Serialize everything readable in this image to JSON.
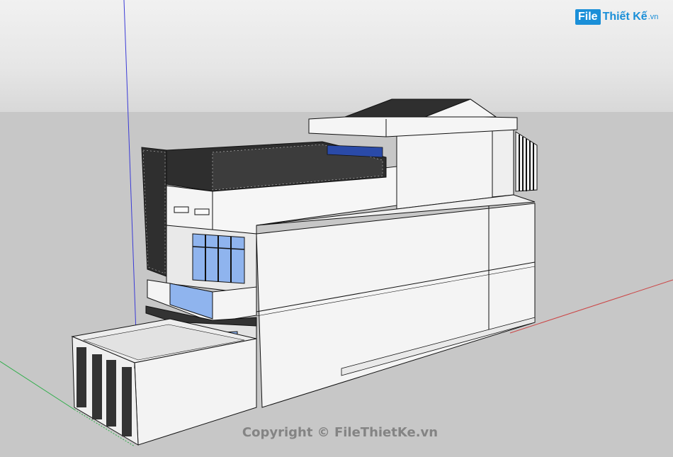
{
  "logo": {
    "box": "File",
    "name": "Thiết Kế",
    "ext": ".vn"
  },
  "watermark": "Copyright © FileThietKe.vn",
  "colors": {
    "ground": "#c7c7c7",
    "sky": "#e9e9e9",
    "wall": "#f4f4f4",
    "glass": "#8fb4ee",
    "roof": "#2f2f2f",
    "axis_red": "#cc4444",
    "axis_green": "#2fae4a",
    "axis_blue": "#3b3bd6",
    "brand": "#1a8fd8"
  }
}
